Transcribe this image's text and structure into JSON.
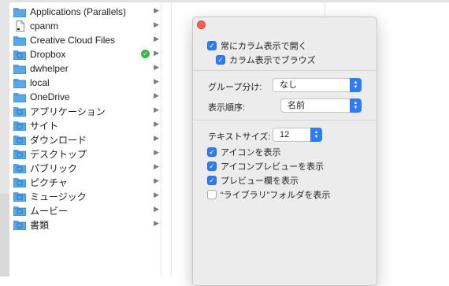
{
  "sidebar": {
    "items": [
      {
        "label": "Applications (Parallels)",
        "icon": "folder-icon"
      },
      {
        "label": "cpanm",
        "icon": "document-icon"
      },
      {
        "label": "Creative Cloud Files",
        "icon": "folder-icon"
      },
      {
        "label": "Dropbox",
        "icon": "dropbox-folder-icon",
        "badge": "✓"
      },
      {
        "label": "dwhelper",
        "icon": "folder-icon"
      },
      {
        "label": "local",
        "icon": "folder-icon"
      },
      {
        "label": "OneDrive",
        "icon": "folder-icon"
      },
      {
        "label": "アプリケーション",
        "icon": "applications-folder-icon"
      },
      {
        "label": "サイト",
        "icon": "sites-folder-icon"
      },
      {
        "label": "ダウンロード",
        "icon": "downloads-folder-icon"
      },
      {
        "label": "デスクトップ",
        "icon": "desktop-folder-icon"
      },
      {
        "label": "パブリック",
        "icon": "public-folder-icon"
      },
      {
        "label": "ピクチャ",
        "icon": "pictures-folder-icon"
      },
      {
        "label": "ミュージック",
        "icon": "music-folder-icon"
      },
      {
        "label": "ムービー",
        "icon": "movies-folder-icon"
      },
      {
        "label": "書類",
        "icon": "documents-folder-icon"
      }
    ],
    "arrow": "▶"
  },
  "options": {
    "always_open_column": "常にカラム表示で開く",
    "browse_in_column": "カラム表示でブラウズ",
    "group_by_label": "グループ分け:",
    "group_by_value": "なし",
    "sort_by_label": "表示順序:",
    "sort_by_value": "名前",
    "text_size_label": "テキストサイズ:",
    "text_size_value": "12",
    "show_icons": "アイコンを表示",
    "show_icon_preview": "アイコンプレビューを表示",
    "show_preview_column": "プレビュー欄を表示",
    "show_library_folder": "“ライブラリ”フォルダを表示"
  },
  "checks": {
    "always_open_column": true,
    "browse_in_column": true,
    "show_icons": true,
    "show_icon_preview": true,
    "show_preview_column": true,
    "show_library_folder": false
  },
  "colors": {
    "accent": "#2f7bf6",
    "folder": "#5ba8e8",
    "close": "#fd5f57",
    "badge": "#39b54a"
  }
}
